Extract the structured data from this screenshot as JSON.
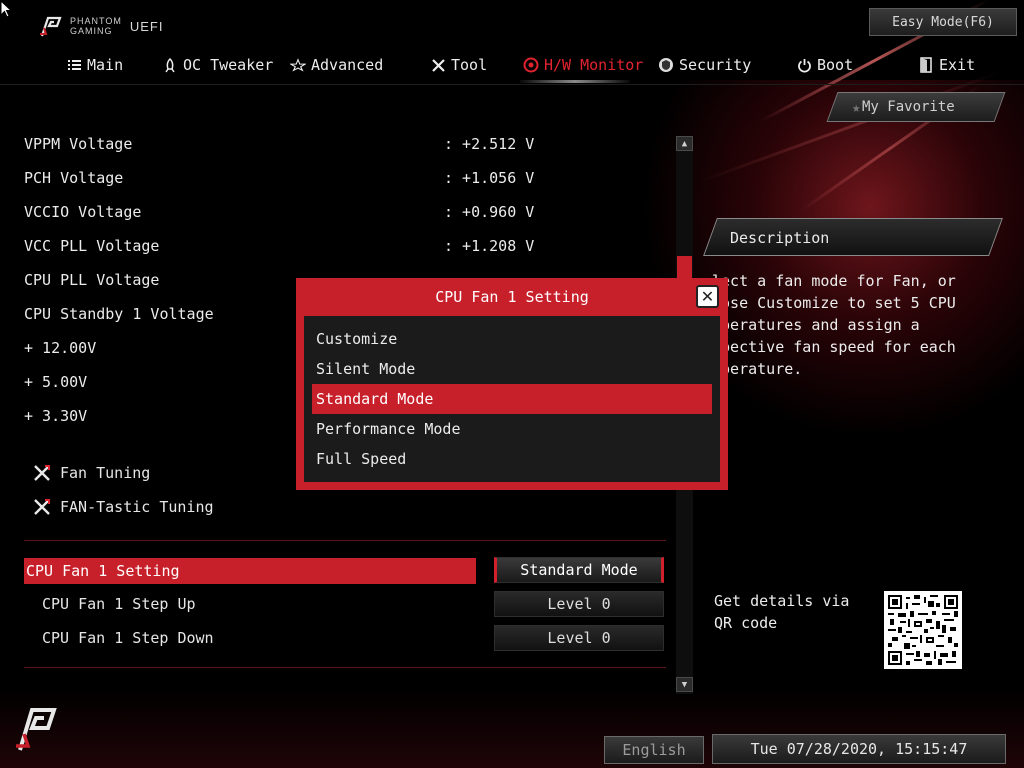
{
  "header": {
    "brand_line1": "PHANTOM",
    "brand_line2": "GAMING",
    "brand_uefi": "UEFI",
    "easy_mode": "Easy Mode(F6)"
  },
  "nav": [
    {
      "label": "Main",
      "icon": "list-icon"
    },
    {
      "label": "OC Tweaker",
      "icon": "rocket-icon"
    },
    {
      "label": "Advanced",
      "icon": "star-icon"
    },
    {
      "label": "Tool",
      "icon": "tools-icon"
    },
    {
      "label": "H/W Monitor",
      "icon": "monitor-gauge-icon",
      "active": true
    },
    {
      "label": "Security",
      "icon": "shield-icon"
    },
    {
      "label": "Boot",
      "icon": "power-icon"
    },
    {
      "label": "Exit",
      "icon": "exit-door-icon"
    }
  ],
  "readings": [
    {
      "label": "VPPM Voltage",
      "value": ": +2.512 V"
    },
    {
      "label": "PCH Voltage",
      "value": ": +1.056 V"
    },
    {
      "label": "VCCIO Voltage",
      "value": ": +0.960 V"
    },
    {
      "label": "VCC PLL Voltage",
      "value": ": +1.208 V"
    },
    {
      "label": "CPU PLL Voltage",
      "value": ""
    },
    {
      "label": "CPU Standby 1 Voltage",
      "value": ""
    },
    {
      "label": "+ 12.00V",
      "value": ""
    },
    {
      "label": "+ 5.00V",
      "value": ""
    },
    {
      "label": "+ 3.30V",
      "value": ""
    }
  ],
  "tools": [
    {
      "label": "Fan Tuning",
      "icon": "wrench-screwdriver-icon"
    },
    {
      "label": "FAN-Tastic Tuning",
      "icon": "wrench-screwdriver-icon"
    }
  ],
  "fan_settings": {
    "selected_label": "CPU Fan 1 Setting",
    "selected_value": "Standard Mode",
    "step_up_label": "CPU Fan 1 Step Up",
    "step_up_value": "Level 0",
    "step_down_label": "CPU Fan 1 Step Down",
    "step_down_value": "Level 0"
  },
  "favorite": {
    "label": "My Favorite"
  },
  "description": {
    "title": "Description",
    "text": "lect a fan mode for Fan, or\noose Customize to set 5 CPU\nmperatures and assign a\nspective fan speed for each\nmperature."
  },
  "qr": {
    "text": "Get details via QR code"
  },
  "modal": {
    "title": "CPU Fan 1 Setting",
    "options": [
      "Customize",
      "Silent Mode",
      "Standard Mode",
      "Performance Mode",
      "Full Speed"
    ],
    "selected_index": 2
  },
  "footer": {
    "language": "English",
    "datetime": "Tue 07/28/2020, 15:15:47"
  },
  "colors": {
    "accent": "#c8202b",
    "active_nav": "#e2232f",
    "background": "#000000"
  }
}
